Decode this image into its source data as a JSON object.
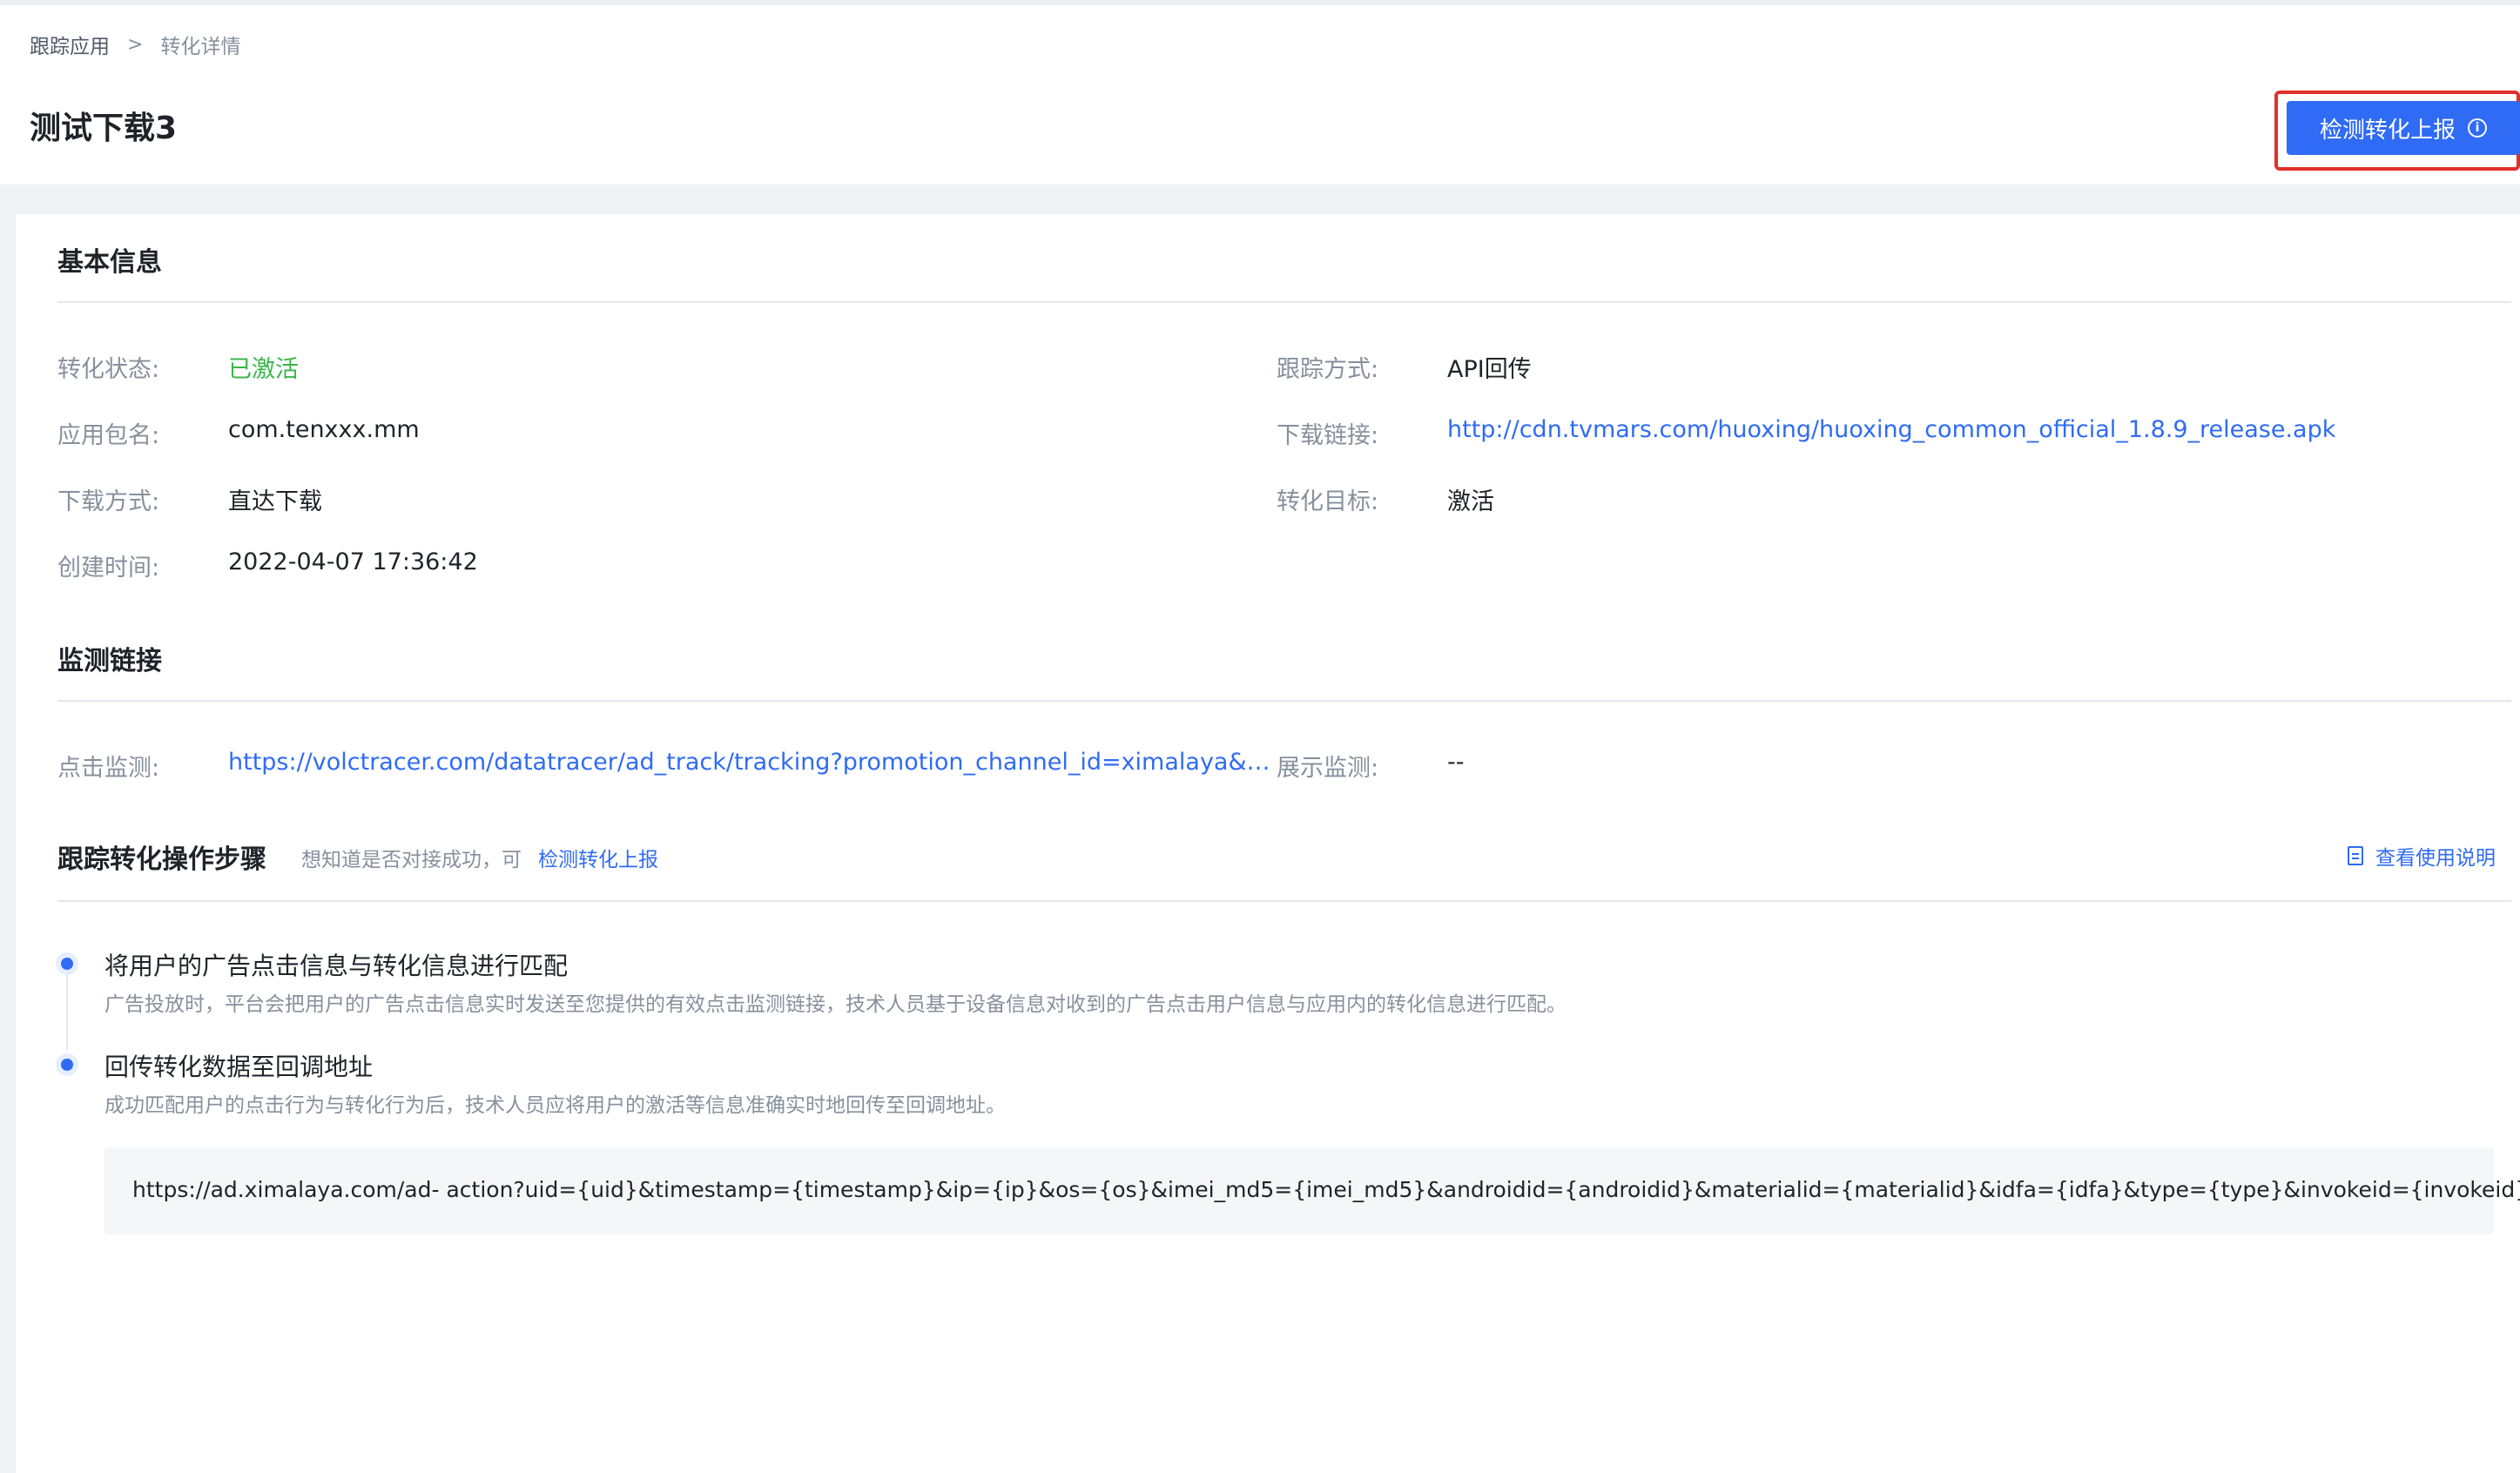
{
  "breadcrumb": {
    "parent": "跟踪应用",
    "separator": ">",
    "current": "转化详情"
  },
  "page": {
    "title": "测试下载3"
  },
  "primary_action": {
    "label": "检测转化上报",
    "icon": "info-icon"
  },
  "basic_info": {
    "title": "基本信息",
    "left": [
      {
        "label": "转化状态:",
        "value": "已激活"
      },
      {
        "label": "应用包名:",
        "value": "com.tenxxx.mm"
      },
      {
        "label": "下载方式:",
        "value": "直达下载"
      },
      {
        "label": "创建时间:",
        "value": "2022-04-07 17:36:42"
      }
    ],
    "right": [
      {
        "label": "跟踪方式:",
        "value": "API回传"
      },
      {
        "label": "下载链接:",
        "value": "http://cdn.tvmars.com/huoxing/huoxing_common_official_1.8.9_release.apk"
      },
      {
        "label": "转化目标:",
        "value": "激活"
      }
    ]
  },
  "monitor": {
    "title": "监测链接",
    "click_label": "点击监测:",
    "click_value": "https://volctracer.com/datatracer/ad_track/tracking?promotion_channel_id=ximalaya&ac…",
    "display_label": "展示监测:",
    "display_value": "--"
  },
  "steps_section": {
    "title": "跟踪转化操作步骤",
    "hint": "想知道是否对接成功，可",
    "hint_link": "检测转化上报",
    "doc_link": "查看使用说明",
    "doc_icon": "document-icon",
    "steps": [
      {
        "title": "将用户的广告点击信息与转化信息进行匹配",
        "desc": "广告投放时，平台会把用户的广告点击信息实时发送至您提供的有效点击监测链接，技术人员基于设备信息对收到的广告点击用户信息与应用内的转化信息进行匹配。"
      },
      {
        "title": "回传转化数据至回调地址",
        "desc": "成功匹配用户的点击行为与转化行为后，技术人员应将用户的激活等信息准确实时地回传至回调地址。"
      }
    ],
    "callback_url": "https://ad.ximalaya.com/ad- action?uid={uid}&timestamp={timestamp}&ip={ip}&os={os}&imei_md5={imei_md5}&androidid={androidid}&materialid={materialid}&idfa={idfa}&type={type}&invokeid={invokeid}"
  },
  "colors": {
    "primary": "#2f6bf5",
    "success": "#3ab54a",
    "highlight_border": "#e0302a"
  }
}
